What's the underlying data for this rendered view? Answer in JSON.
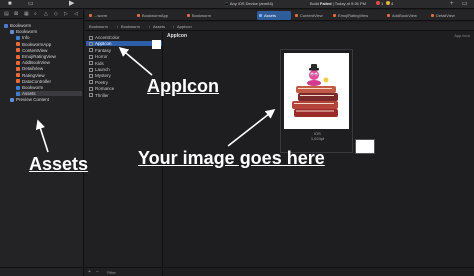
{
  "window": {
    "ios_device": "Any iOS Device (arm64)",
    "build_status_prefix": "Build ",
    "build_status_strong": "Failed",
    "build_status_time": " | Today at 9:26 PM",
    "error_count": "1",
    "warning_count": "4"
  },
  "tabs": [
    {
      "label": "...worm"
    },
    {
      "label": "BookwormApp"
    },
    {
      "label": "Bookworm"
    },
    {
      "label": "Assets"
    },
    {
      "label": "ContentView"
    },
    {
      "label": "EmojiRatingView"
    },
    {
      "label": "AddBookView"
    },
    {
      "label": "DetailView"
    }
  ],
  "breadcrumbs": [
    "Bookworm",
    "Bookworm",
    "Assets",
    "AppIcon"
  ],
  "navigator": {
    "items": [
      {
        "label": "Bookworm",
        "type": "proj"
      },
      {
        "label": "Bookworm",
        "type": "folder"
      },
      {
        "label": "Info",
        "type": "asset"
      },
      {
        "label": "BookwormApp",
        "type": "swift"
      },
      {
        "label": "ContentView",
        "type": "swift"
      },
      {
        "label": "EmojiRatingView",
        "type": "swift"
      },
      {
        "label": "AddBookView",
        "type": "swift"
      },
      {
        "label": "DetailView",
        "type": "swift"
      },
      {
        "label": "RatingView",
        "type": "swift"
      },
      {
        "label": "DataController",
        "type": "swift"
      },
      {
        "label": "Bookworm",
        "type": "asset"
      },
      {
        "label": "Assets",
        "type": "asset"
      },
      {
        "label": "Preview Content",
        "type": "folder"
      }
    ]
  },
  "asset_catalog": {
    "items": [
      "AccentColor",
      "AppIcon",
      "Fantasy",
      "Horror",
      "Kids",
      "Launch",
      "Mystery",
      "Poetry",
      "Romance",
      "Thriller"
    ],
    "filter_placeholder": "Filter"
  },
  "canvas": {
    "title": "AppIcon",
    "right_label": "App Icon",
    "image_label_line1": "iOS",
    "image_label_line2": "1,024pt"
  },
  "annotations": {
    "appicon": "AppIcon",
    "assets": "Assets",
    "your_image": "Your image goes here"
  },
  "colors": {
    "accent": "#2f5ea8",
    "annotation": "#ffffff",
    "error": "#e34b3f",
    "warning": "#e4b33b"
  }
}
